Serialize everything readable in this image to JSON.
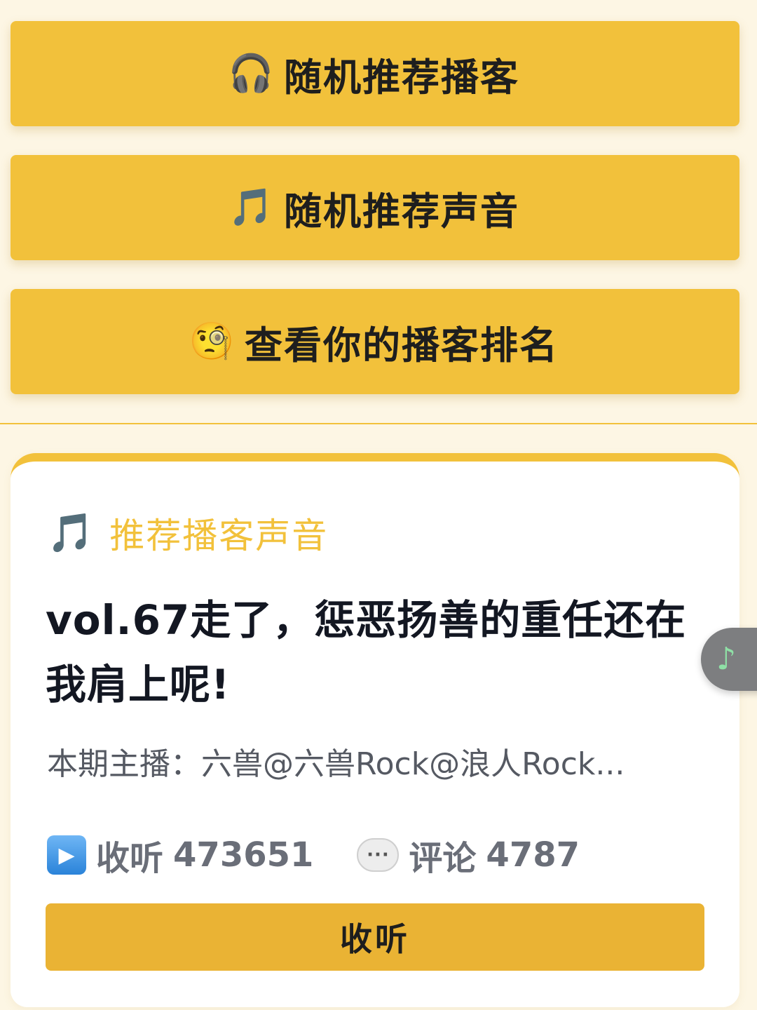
{
  "actions": [
    {
      "id": "btn1",
      "icon": "headphones-icon",
      "glyph": "🎧",
      "label": "随机推荐播客"
    },
    {
      "id": "btn2",
      "icon": "music-notes-icon",
      "glyph": "🎵",
      "label": "随机推荐声音"
    },
    {
      "id": "btn3",
      "icon": "monocle-face-icon",
      "glyph": "🧐",
      "label": "查看你的播客排名"
    }
  ],
  "card": {
    "heading_icon": "🎵",
    "heading": "推荐播客声音",
    "title": "vol.67走了，惩恶扬善的重任还在我肩上呢!",
    "host": "本期主播：六兽@六兽Rock@浪人Rock...",
    "listen_label": "收听",
    "listen_count": "473651",
    "comment_label": "评论",
    "comment_count": "4787",
    "listen_button": "收听"
  },
  "floating_music": {
    "glyph": "♪"
  },
  "colors": {
    "accent": "#F2C13B",
    "background": "#FDF6E4",
    "listen_button": "#EAB334"
  }
}
